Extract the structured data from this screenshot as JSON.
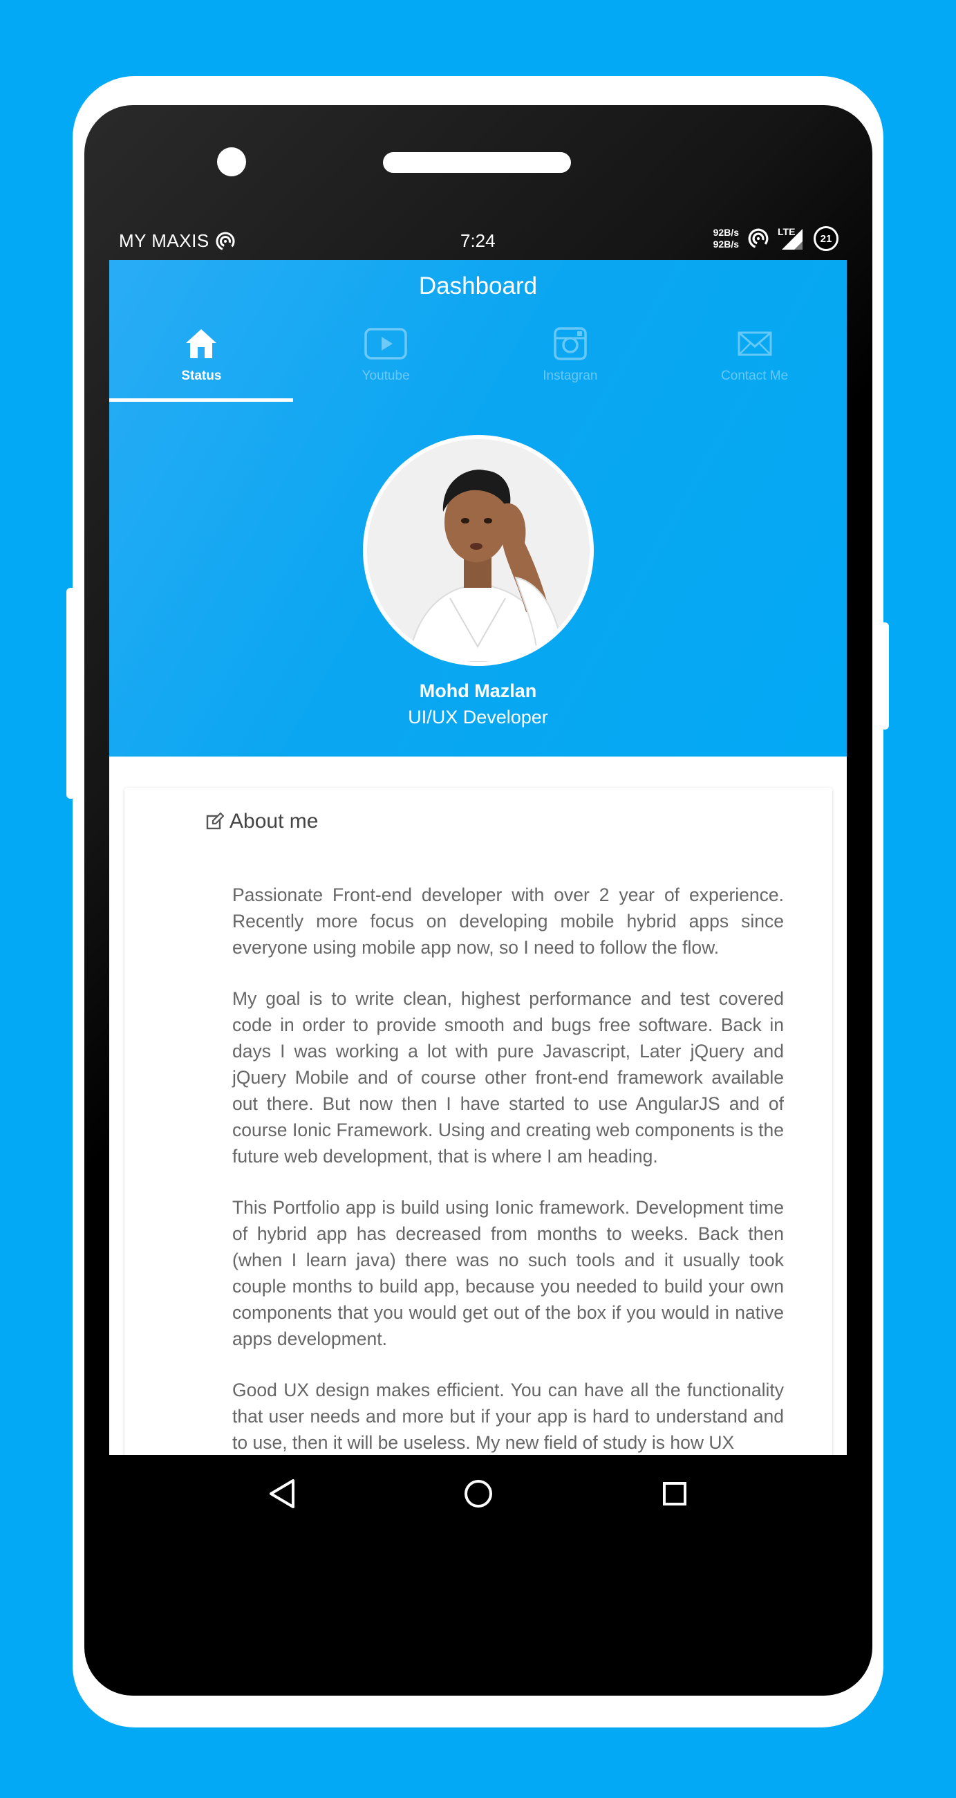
{
  "status_bar": {
    "carrier": "MY MAXIS",
    "time": "7:24",
    "speed_up": "92B/s",
    "speed_down": "92B/s",
    "network": "LTE",
    "battery": "21"
  },
  "app": {
    "title": "Dashboard",
    "tabs": [
      {
        "label": "Status",
        "icon": "home-icon",
        "active": true
      },
      {
        "label": "Youtube",
        "icon": "youtube-icon",
        "active": false
      },
      {
        "label": "Instagran",
        "icon": "instagram-icon",
        "active": false
      },
      {
        "label": "Contact Me",
        "icon": "mail-icon",
        "active": false
      }
    ]
  },
  "profile": {
    "name": "Mohd Mazlan",
    "role": "UI/UX Developer"
  },
  "about": {
    "title": "About me",
    "paragraphs": [
      "Passionate Front-end developer with over 2 year of experience. Recently more focus on developing mobile hybrid apps since everyone using mobile app now, so I need to follow the flow.",
      "My goal is to write clean, highest performance and test covered code in order to provide smooth and bugs free software. Back in days I was working a lot with pure Javascript, Later jQuery and jQuery Mobile and of course other front-end framework available out there. But now then I have started to use AngularJS and of course Ionic Framework. Using and creating web components is the future web development, that is where I am heading.",
      "This Portfolio app is build using Ionic framework. Development time of hybrid app has decreased from months to weeks. Back then (when I learn java) there was no such tools and it usually took couple months to build app, because you needed to build your own components that you would get out of the box if you would in native apps development.",
      "Good UX design makes efficient. You can have all the functionality that user needs and more but if your app is hard to understand and to use, then it will be useless. My new field of study is how UX"
    ]
  },
  "colors": {
    "background": "#03a9f4",
    "header": "#0ba6f1",
    "text_body": "#666666"
  }
}
